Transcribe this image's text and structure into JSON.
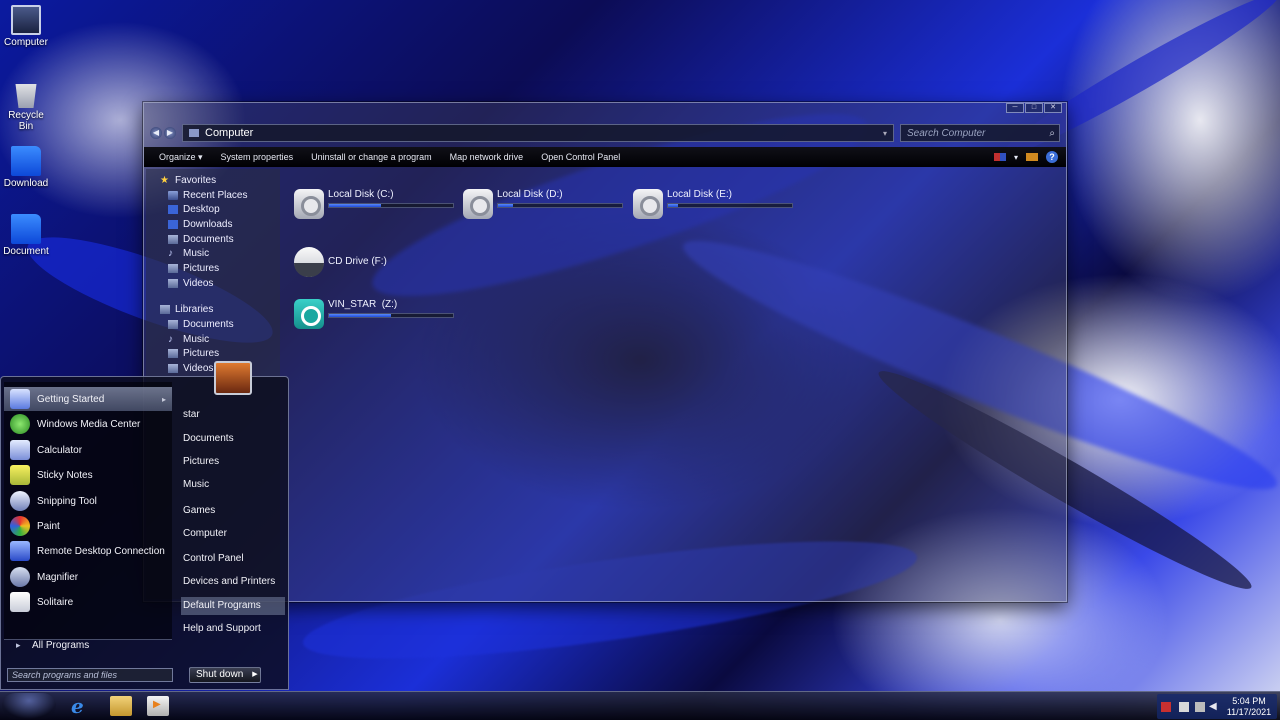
{
  "desktop": {
    "icons": [
      {
        "label": "Computer",
        "icon": "computer-icon"
      },
      {
        "label": "Recycle Bin",
        "icon": "recycle-bin-icon"
      },
      {
        "label": "Download",
        "icon": "folder-icon"
      },
      {
        "label": "Document",
        "icon": "folder-icon"
      }
    ]
  },
  "explorer": {
    "address": "Computer",
    "search_placeholder": "Search Computer",
    "commands": [
      "Organize ▾",
      "System properties",
      "Uninstall or change a program",
      "Map network drive",
      "Open Control Panel"
    ],
    "nav": {
      "favorites_header": "Favorites",
      "favorites": [
        "Recent Places",
        "Desktop",
        "Downloads",
        "Documents",
        "Music",
        "Pictures",
        "Videos"
      ],
      "libraries_header": "Libraries",
      "libraries": [
        "Documents",
        "Music",
        "Pictures",
        "Videos"
      ]
    },
    "drives": [
      {
        "name": "Local Disk (C:)",
        "type": "hdd",
        "used_fraction": 0.42
      },
      {
        "name": "Local Disk (D:)",
        "type": "hdd",
        "used_fraction": 0.12
      },
      {
        "name": "Local Disk (E:)",
        "type": "hdd",
        "used_fraction": 0.08
      },
      {
        "name": "CD Drive (F:)",
        "type": "cd"
      },
      {
        "name": "VIN_STAR  (Z:)",
        "type": "network",
        "used_fraction": 0.5
      }
    ]
  },
  "start_menu": {
    "programs": [
      {
        "label": "Getting Started",
        "icon": "getting-started-icon",
        "highlighted": true,
        "has_submenu": true
      },
      {
        "label": "Windows Media Center",
        "icon": "media-center-icon"
      },
      {
        "label": "Calculator",
        "icon": "calculator-icon"
      },
      {
        "label": "Sticky Notes",
        "icon": "sticky-notes-icon"
      },
      {
        "label": "Snipping Tool",
        "icon": "snipping-tool-icon"
      },
      {
        "label": "Paint",
        "icon": "paint-icon"
      },
      {
        "label": "Remote Desktop Connection",
        "icon": "remote-desktop-icon"
      },
      {
        "label": "Magnifier",
        "icon": "magnifier-icon"
      },
      {
        "label": "Solitaire",
        "icon": "solitaire-icon"
      }
    ],
    "all_programs": "All Programs",
    "search_placeholder": "Search programs and files",
    "right_items": [
      "star",
      "Documents",
      "Pictures",
      "Music",
      "Games",
      "Computer",
      "Control Panel",
      "Devices and Printers",
      "Default Programs",
      "Help and Support"
    ],
    "highlighted_right_item": "Default Programs",
    "shutdown_label": "Shut down"
  },
  "taskbar": {
    "pinned": [
      "internet-explorer-icon",
      "file-explorer-icon",
      "media-player-icon"
    ],
    "clock_time": "5:04 PM",
    "clock_date": "11/17/2021"
  },
  "colors": {
    "accent_blue": "#1f4ad8",
    "window_glass": "#46485c",
    "section_title": "#466eff"
  }
}
